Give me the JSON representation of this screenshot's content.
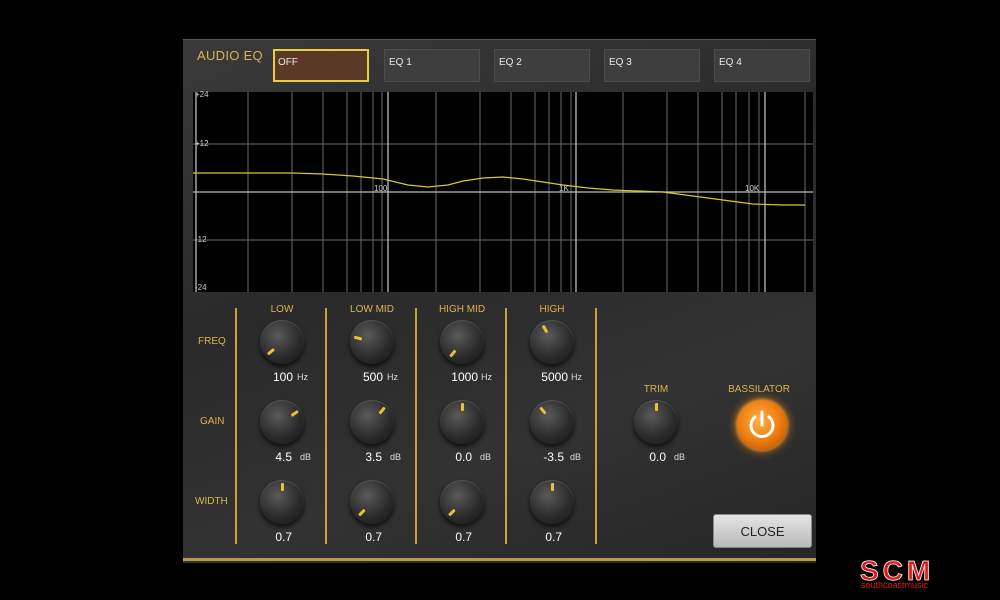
{
  "header": {
    "title": "AUDIO EQ"
  },
  "presets": [
    "OFF",
    "EQ 1",
    "EQ 2",
    "EQ 3",
    "EQ 4"
  ],
  "active_preset": "OFF",
  "graph": {
    "y_ticks": [
      "+24",
      "+12",
      "-12",
      "-24"
    ],
    "x_ticks": [
      "100",
      "1K",
      "10K"
    ],
    "curve_color": "#d8c92c"
  },
  "rows": {
    "freq": "FREQ",
    "gain": "GAIN",
    "width": "WIDTH"
  },
  "bands": [
    {
      "label": "LOW",
      "freq": "100",
      "freq_unit": "Hz",
      "gain": "4.5",
      "gain_unit": "dB",
      "width": "0.7"
    },
    {
      "label": "LOW MID",
      "freq": "500",
      "freq_unit": "Hz",
      "gain": "3.5",
      "gain_unit": "dB",
      "width": "0.7"
    },
    {
      "label": "HIGH MID",
      "freq": "1000",
      "freq_unit": "Hz",
      "gain": "0.0",
      "gain_unit": "dB",
      "width": "0.7"
    },
    {
      "label": "HIGH",
      "freq": "5000",
      "freq_unit": "Hz",
      "gain": "-3.5",
      "gain_unit": "dB",
      "width": "0.7"
    }
  ],
  "trim": {
    "label": "TRIM",
    "value": "0.0",
    "unit": "dB"
  },
  "bassilator": {
    "label": "BASSILATOR",
    "state": "on"
  },
  "close_label": "CLOSE",
  "logo": {
    "mark": "SCM",
    "text": "southcoastmusic"
  },
  "colors": {
    "accent": "#d9b450",
    "active_border": "#e7cf3a",
    "bassilator": "#f07d10",
    "logo_red": "#e01818"
  }
}
